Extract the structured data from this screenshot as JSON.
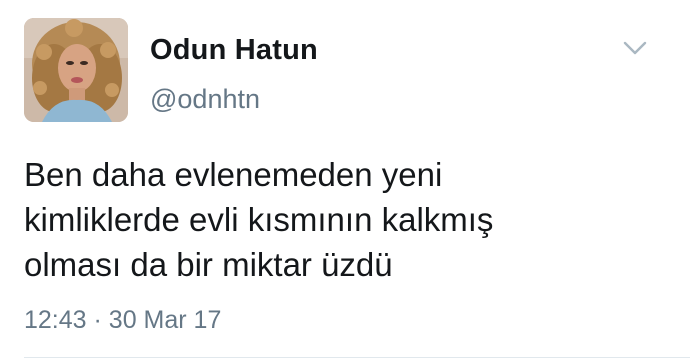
{
  "tweet": {
    "author": {
      "display_name": "Odun Hatun",
      "handle": "@odnhtn"
    },
    "text_lines": [
      "Ben daha evlenemeden yeni",
      "kimliklerde evli kısmının kalkmış",
      "olması da bir miktar üzdü"
    ],
    "timestamp": {
      "time": "12:43",
      "separator": "·",
      "date": "30 Mar 17"
    },
    "menu_icon": "chevron-down-icon"
  },
  "colors": {
    "primary_text": "#14171a",
    "secondary_text": "#657786",
    "divider": "#e1e8ed",
    "chevron": "#aab8c2"
  }
}
